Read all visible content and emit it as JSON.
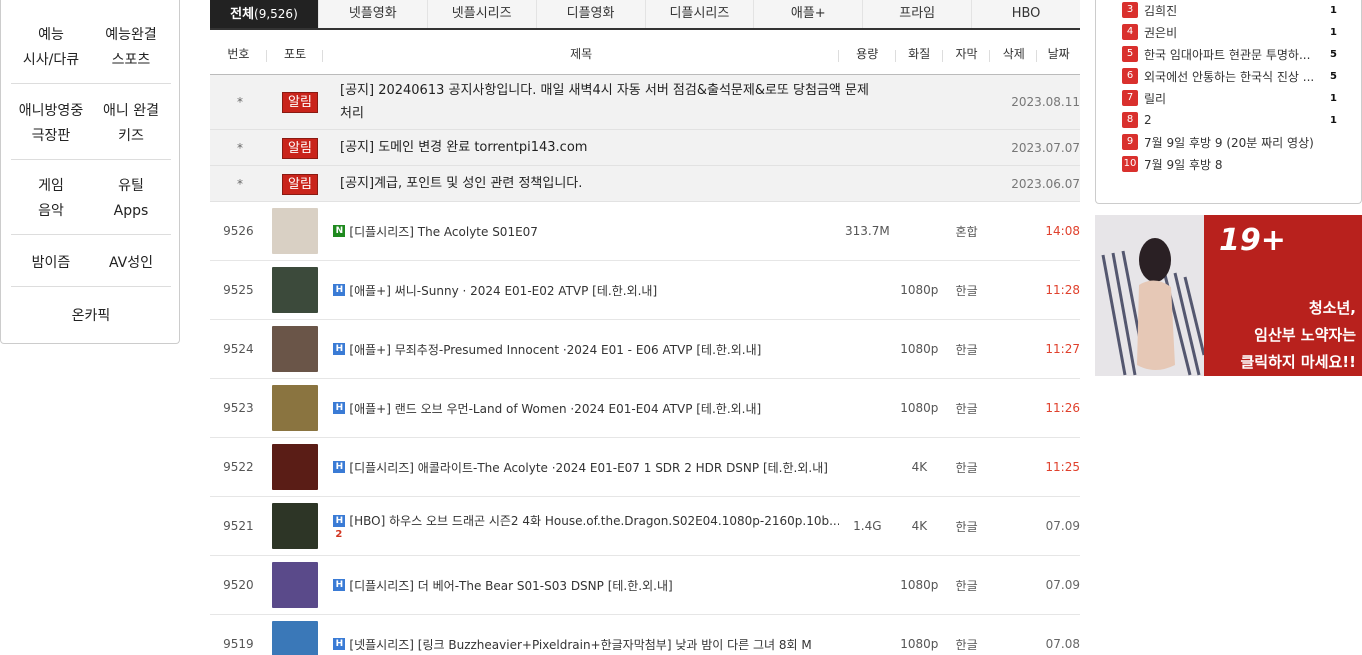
{
  "sidebar": {
    "groups": [
      [
        [
          "예능",
          "예능완결"
        ],
        [
          "시사/다큐",
          "스포츠"
        ]
      ],
      [
        [
          "애니방영중",
          "애니 완결"
        ],
        [
          "극장판",
          "키즈"
        ]
      ],
      [
        [
          "게임",
          "유틸"
        ],
        [
          "음악",
          "Apps"
        ]
      ],
      [
        [
          "밤이즘",
          "AV성인"
        ]
      ],
      [
        [
          "온카픽"
        ]
      ]
    ]
  },
  "tabs": [
    {
      "label": "전체",
      "count": "(9,526)",
      "active": true
    },
    {
      "label": "넷플영화"
    },
    {
      "label": "넷플시리즈"
    },
    {
      "label": "디플영화"
    },
    {
      "label": "디플시리즈"
    },
    {
      "label": "애플+"
    },
    {
      "label": "프라임"
    },
    {
      "label": "HBO"
    }
  ],
  "table": {
    "headers": {
      "num": "번호",
      "photo": "포토",
      "title": "제목",
      "size": "용량",
      "quality": "화질",
      "subtitle": "자막",
      "delete": "삭제",
      "date": "날짜"
    },
    "notices": [
      {
        "num": "*",
        "badge": "알림",
        "title": "[공지] 20240613 공지사항입니다. 매일 새벽4시 자동 서버 점검&출석문제&로또 당첨금액 문제 처리",
        "date": "2023.08.11"
      },
      {
        "num": "*",
        "badge": "알림",
        "title": "[공지] 도메인 변경 완료 torrentpi143.com",
        "date": "2023.07.07"
      },
      {
        "num": "*",
        "badge": "알림",
        "title": "[공지]계급, 포인트 및 성인 관련 정책입니다.",
        "date": "2023.06.07"
      }
    ],
    "rows": [
      {
        "num": "9526",
        "tag": "N",
        "title": "[디플시리즈] The Acolyte S01E07",
        "size": "313.7M",
        "quality": "",
        "subtitle": "혼합",
        "date": "14:08",
        "comments": "",
        "thumb_color": "#d9d0c4"
      },
      {
        "num": "9525",
        "tag": "H",
        "title": "[애플+] 써니-Sunny · 2024 E01-E02 ATVP [테.한.외.내]",
        "size": "",
        "quality": "1080p",
        "subtitle": "한글",
        "date": "11:28",
        "comments": "",
        "thumb_color": "#3c4a3b"
      },
      {
        "num": "9524",
        "tag": "H",
        "title": "[애플+] 무죄추정-Presumed Innocent ·2024 E01 - E06 ATVP [테.한.외.내]",
        "size": "",
        "quality": "1080p",
        "subtitle": "한글",
        "date": "11:27",
        "comments": "",
        "thumb_color": "#6a5548"
      },
      {
        "num": "9523",
        "tag": "H",
        "title": "[애플+] 랜드 오브 우먼-Land of Women ·2024 E01-E04 ATVP [테.한.외.내]",
        "size": "",
        "quality": "1080p",
        "subtitle": "한글",
        "date": "11:26",
        "comments": "",
        "thumb_color": "#8a7440"
      },
      {
        "num": "9522",
        "tag": "H",
        "title": "[디플시리즈] 애콜라이트-The Acolyte ·2024 E01-E07 1 SDR 2 HDR DSNP [테.한.외.내]",
        "size": "",
        "quality": "4K",
        "subtitle": "한글",
        "date": "11:25",
        "comments": "",
        "thumb_color": "#5a1d16"
      },
      {
        "num": "9521",
        "tag": "H",
        "title": "[HBO] 하우스 오브 드래곤 시즌2 4화 House.of.the.Dragon.S02E04.1080p-2160p.10b...",
        "size": "1.4G",
        "quality": "4K",
        "subtitle": "한글",
        "date": "07.09",
        "comments": "2",
        "thumb_color": "#2d3526"
      },
      {
        "num": "9520",
        "tag": "H",
        "title": "[디플시리즈] 더 베어-The Bear S01-S03 DSNP [테.한.외.내]",
        "size": "",
        "quality": "1080p",
        "subtitle": "한글",
        "date": "07.09",
        "comments": "",
        "thumb_color": "#5a4a8a"
      },
      {
        "num": "9519",
        "tag": "H",
        "title": "[넷플시리즈] [링크 Buzzheavier+Pixeldrain+한글자막첨부] 낮과 밤이 다른 그녀 8회 M",
        "size": "",
        "quality": "1080p",
        "subtitle": "한글",
        "date": "07.08",
        "comments": "",
        "thumb_color": "#3a78b8"
      }
    ]
  },
  "ranking": [
    {
      "rank": "3",
      "text": "김희진",
      "count": "1"
    },
    {
      "rank": "4",
      "text": "권은비",
      "count": "1"
    },
    {
      "rank": "5",
      "text": "한국 임대아파트 현관문 투명하...",
      "count": "5"
    },
    {
      "rank": "6",
      "text": "외국에선 안통하는 한국식 진상 ...",
      "count": "5"
    },
    {
      "rank": "7",
      "text": "릴리",
      "count": "1"
    },
    {
      "rank": "8",
      "text": "2",
      "count": "1"
    },
    {
      "rank": "9",
      "text": "7월 9일 후방 9 (20분 짜리 영상)",
      "count": ""
    },
    {
      "rank": "10",
      "text": "7월 9일 후방 8",
      "count": ""
    }
  ],
  "ad": {
    "age": "19+",
    "line1": "청소년,",
    "line2": "임산부 노약자는",
    "line3": "클릭하지 마세요!!"
  }
}
